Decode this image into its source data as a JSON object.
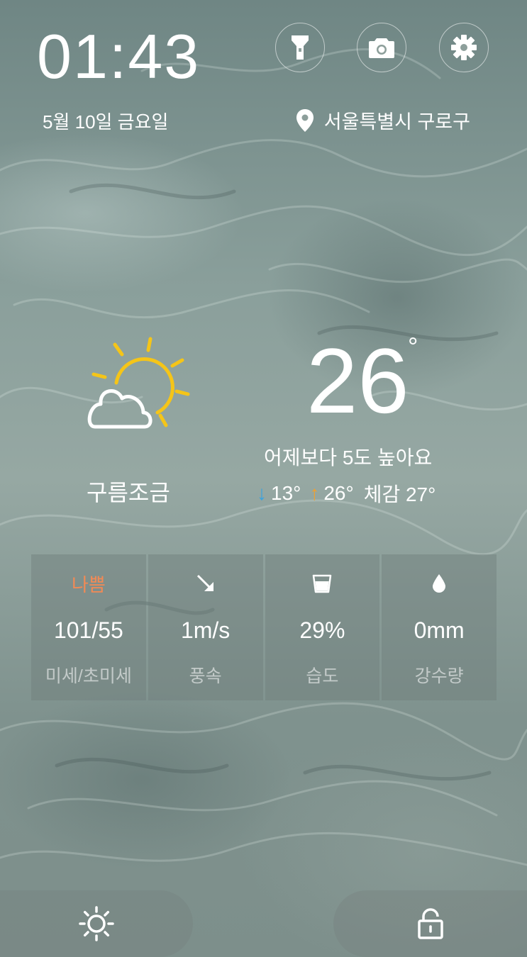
{
  "clock": {
    "time": "01:43",
    "date": "5월 10일 금요일"
  },
  "toolbar": {
    "flashlight_icon": "flashlight-icon",
    "camera_icon": "camera-icon",
    "settings_icon": "gear-icon"
  },
  "location": {
    "icon": "location-pin-icon",
    "name": "서울특별시 구로구"
  },
  "weather": {
    "icon": "partly-cloudy-icon",
    "condition": "구름조금",
    "temperature": "26",
    "degree_symbol": "°",
    "comparison": "어제보다 5도 높아요",
    "low_arrow": "↓",
    "low": "13°",
    "high_arrow": "↑",
    "high": "26°",
    "feels_like": "체감 27°"
  },
  "details": {
    "dust": {
      "status": "나쁨",
      "value": "101/55",
      "label": "미세/초미세",
      "status_color": "#f28a55"
    },
    "wind": {
      "icon": "wind-direction-arrow-icon",
      "value": "1m/s",
      "label": "풍속"
    },
    "humidity": {
      "icon": "cup-icon",
      "value": "29%",
      "label": "습도"
    },
    "rain": {
      "icon": "raindrop-icon",
      "value": "0mm",
      "label": "강수량"
    }
  },
  "bottom": {
    "brightness_icon": "brightness-icon",
    "unlock_icon": "unlock-icon"
  },
  "colors": {
    "low_arrow": "#39a3e0",
    "high_arrow": "#f0a030",
    "sun": "#f5c518"
  }
}
